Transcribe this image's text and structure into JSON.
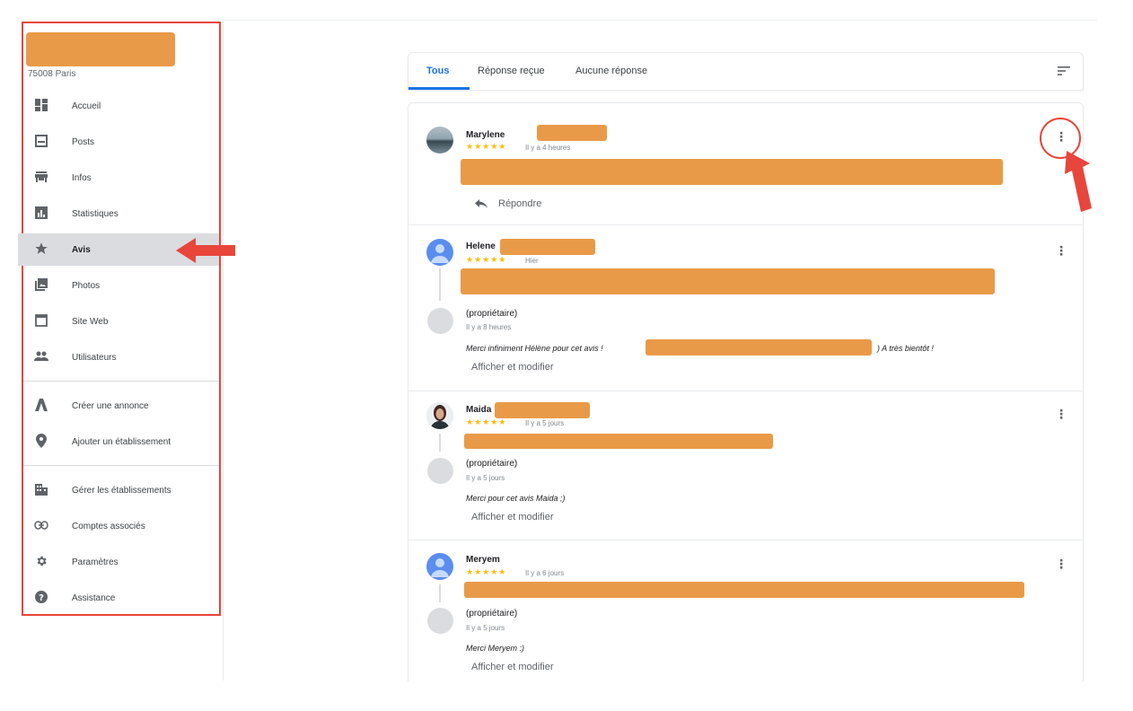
{
  "business": {
    "address": "75008 Paris"
  },
  "sidebar": {
    "items": [
      {
        "label": "Accueil",
        "icon": "dashboard-icon"
      },
      {
        "label": "Posts",
        "icon": "posts-icon"
      },
      {
        "label": "Infos",
        "icon": "store-icon"
      },
      {
        "label": "Statistiques",
        "icon": "bar-chart-icon"
      },
      {
        "label": "Avis",
        "icon": "star-icon",
        "active": true
      },
      {
        "label": "Photos",
        "icon": "photos-icon"
      },
      {
        "label": "Site Web",
        "icon": "website-icon"
      },
      {
        "label": "Utilisateurs",
        "icon": "users-icon"
      }
    ],
    "items2": [
      {
        "label": "Créer une annonce",
        "icon": "ads-icon"
      },
      {
        "label": "Ajouter un établissement",
        "icon": "add-location-icon"
      }
    ],
    "items3": [
      {
        "label": "Gérer les établissements",
        "icon": "buildings-icon"
      },
      {
        "label": "Comptes associés",
        "icon": "link-icon"
      },
      {
        "label": "Paramètres",
        "icon": "settings-icon"
      },
      {
        "label": "Assistance",
        "icon": "help-icon"
      }
    ]
  },
  "tabs": [
    {
      "label": "Tous",
      "active": true
    },
    {
      "label": "Réponse reçue"
    },
    {
      "label": "Aucune réponse"
    }
  ],
  "reviews": [
    {
      "name": "Marylene",
      "stars": "★★★★★",
      "time": "Il y a 4 heures",
      "reply_label": "Répondre"
    },
    {
      "name": "Helene",
      "stars": "★★★★★",
      "time": "Hier",
      "owner": {
        "label": "(propriétaire)",
        "time": "Il y a 8 heures",
        "text_before": "Merci infiniment Hélène pour cet avis !",
        "text_after": ") A très bientôt !",
        "edit_label": "Afficher et modifier"
      }
    },
    {
      "name": "Maida",
      "stars": "★★★★★",
      "time": "Il y a 5 jours",
      "owner": {
        "label": "(propriétaire)",
        "time": "Il y a 5 jours",
        "text": "Merci pour cet avis Maida ;)",
        "edit_label": "Afficher et modifier"
      }
    },
    {
      "name": "Meryem",
      "stars": "★★★★★",
      "time": "Il y a 6 jours",
      "owner": {
        "label": "(propriétaire)",
        "time": "Il y a 5 jours",
        "text": "Merci Meryem :)",
        "edit_label": "Afficher et modifier"
      }
    }
  ],
  "colors": {
    "accent": "#1a73e8",
    "annotation": "#e8453c",
    "redaction": "#e99a48",
    "stars": "#fbbc04"
  }
}
